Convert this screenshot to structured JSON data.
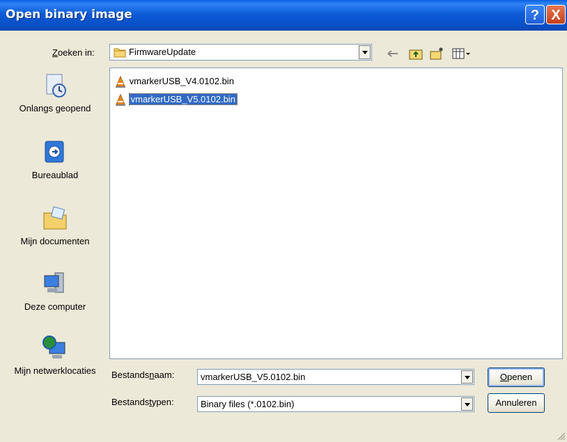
{
  "window": {
    "title": "Open binary image",
    "help_glyph": "?",
    "close_glyph": "X"
  },
  "lookin": {
    "label_prefix": "",
    "label_accel": "Z",
    "label_rest": "oeken in:",
    "value": "FirmwareUpdate"
  },
  "places": [
    {
      "label": "Onlangs geopend",
      "icon": "recent-icon"
    },
    {
      "label": "Bureaublad",
      "icon": "desktop-icon"
    },
    {
      "label": "Mijn documenten",
      "icon": "my-documents-icon"
    },
    {
      "label": "Deze computer",
      "icon": "my-computer-icon"
    },
    {
      "label": "Mijn netwerklocaties",
      "icon": "network-places-icon"
    }
  ],
  "files": [
    {
      "name": "vmarkerUSB_V4.0102.bin",
      "selected": false
    },
    {
      "name": "vmarkerUSB_V5.0102.bin",
      "selected": true
    }
  ],
  "filename": {
    "label_pre": "Bestands",
    "label_accel": "n",
    "label_post": "aam:",
    "value": "vmarkerUSB_V5.0102.bin"
  },
  "filetype": {
    "label_pre": "Bestands",
    "label_accel": "t",
    "label_post": "ypen:",
    "value": "Binary files (*.0102.bin)"
  },
  "buttons": {
    "open_accel": "O",
    "open_rest": "penen",
    "cancel": "Annuleren"
  },
  "colors": {
    "title_blue": "#0a5fdf",
    "selection": "#316ac5",
    "dialog_bg": "#ece9d8"
  }
}
